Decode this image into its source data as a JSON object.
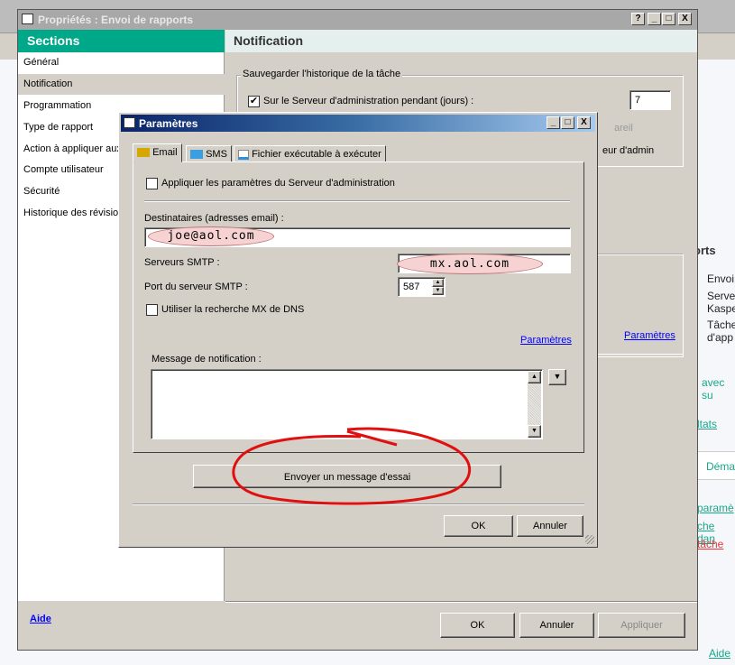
{
  "window": {
    "title": "Propriétés : Envoi de rapports",
    "help": "?",
    "min": "_",
    "max": "□",
    "close": "X"
  },
  "sections": {
    "header": "Sections",
    "items": [
      "Général",
      "Notification",
      "Programmation",
      "Type de rapport",
      "Action à appliquer aux",
      "Compte utilisateur",
      "Sécurité",
      "Historique des révision"
    ],
    "selected": 1
  },
  "notification": {
    "header": "Notification",
    "group_label": "Sauvegarder l'historique de la tâche",
    "checkbox_label": "Sur le Serveur d'administration pendant (jours) :",
    "checked": true,
    "days": "7",
    "partial_line1": "areil",
    "partial_line2": "eur d'admin",
    "params_link": "Paramètres"
  },
  "footer": {
    "help": "Aide",
    "ok": "OK",
    "cancel": "Annuler",
    "apply": "Appliquer"
  },
  "background": {
    "title": "orts",
    "lines": [
      "Envoi",
      "Serve",
      "Kaspe",
      "Tâche",
      "d'app"
    ],
    "link1": "avec su",
    "link2": "ltats",
    "tab": "Déma",
    "link3": "paramè",
    "link4": "che dan",
    "link5": "tâche",
    "help": "Aide"
  },
  "dialog": {
    "title": "Paramètres",
    "tabs": [
      "Email",
      "SMS",
      "Fichier exécutable à exécuter"
    ],
    "apply_admin_label": "Appliquer les paramètres du Serveur d'administration",
    "recipients_label": "Destinataires (adresses email) :",
    "recipients_value": "joe@aol.com",
    "smtp_label": "Serveurs SMTP :",
    "smtp_value": "mx.aol.com",
    "port_label": "Port du serveur SMTP :",
    "port_value": "587",
    "mx_label": "Utiliser la recherche MX de DNS",
    "params_link": "Paramètres",
    "message_label": "Message de notification :",
    "test_button": "Envoyer un message d'essai",
    "ok": "OK",
    "cancel": "Annuler"
  }
}
